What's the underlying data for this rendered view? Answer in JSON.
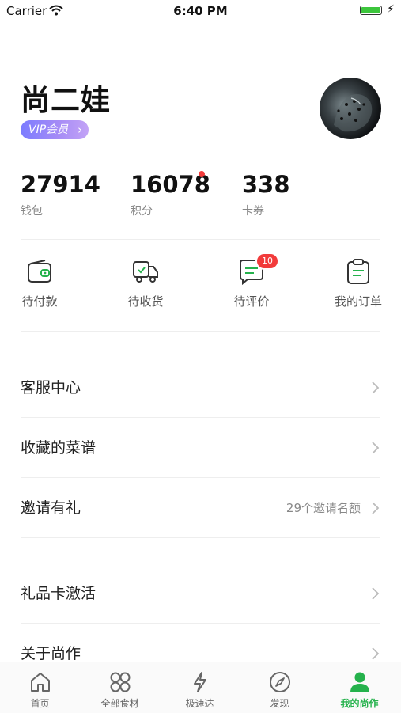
{
  "status_bar": {
    "carrier": "Carrier",
    "time": "6:40 PM"
  },
  "profile": {
    "name": "尚二娃",
    "vip_label": "VIP会员"
  },
  "stats": [
    {
      "value": "27914",
      "label": "钱包"
    },
    {
      "value": "16078",
      "label": "积分"
    },
    {
      "value": "338",
      "label": "卡券"
    }
  ],
  "orders": [
    {
      "label": "待付款",
      "icon": "wallet-icon"
    },
    {
      "label": "待收货",
      "icon": "truck-icon"
    },
    {
      "label": "待评价",
      "icon": "comment-icon",
      "badge": "10"
    },
    {
      "label": "我的订单",
      "icon": "clipboard-icon"
    }
  ],
  "menu": [
    {
      "label": "客服中心"
    },
    {
      "label": "收藏的菜谱"
    },
    {
      "label": "邀请有礼",
      "sub": "29个邀请名额"
    },
    {
      "label": "礼品卡激活"
    },
    {
      "label": "关于尚作"
    }
  ],
  "tabs": [
    {
      "label": "首页",
      "icon": "home-icon"
    },
    {
      "label": "全部食材",
      "icon": "grid-icon"
    },
    {
      "label": "极速达",
      "icon": "lightning-icon"
    },
    {
      "label": "发现",
      "icon": "compass-icon"
    },
    {
      "label": "我的尚作",
      "icon": "user-icon",
      "active": true
    }
  ],
  "colors": {
    "accent": "#25b24c",
    "badge": "#f23b3b",
    "vip_start": "#7b7cff",
    "vip_end": "#c3a3f6"
  }
}
